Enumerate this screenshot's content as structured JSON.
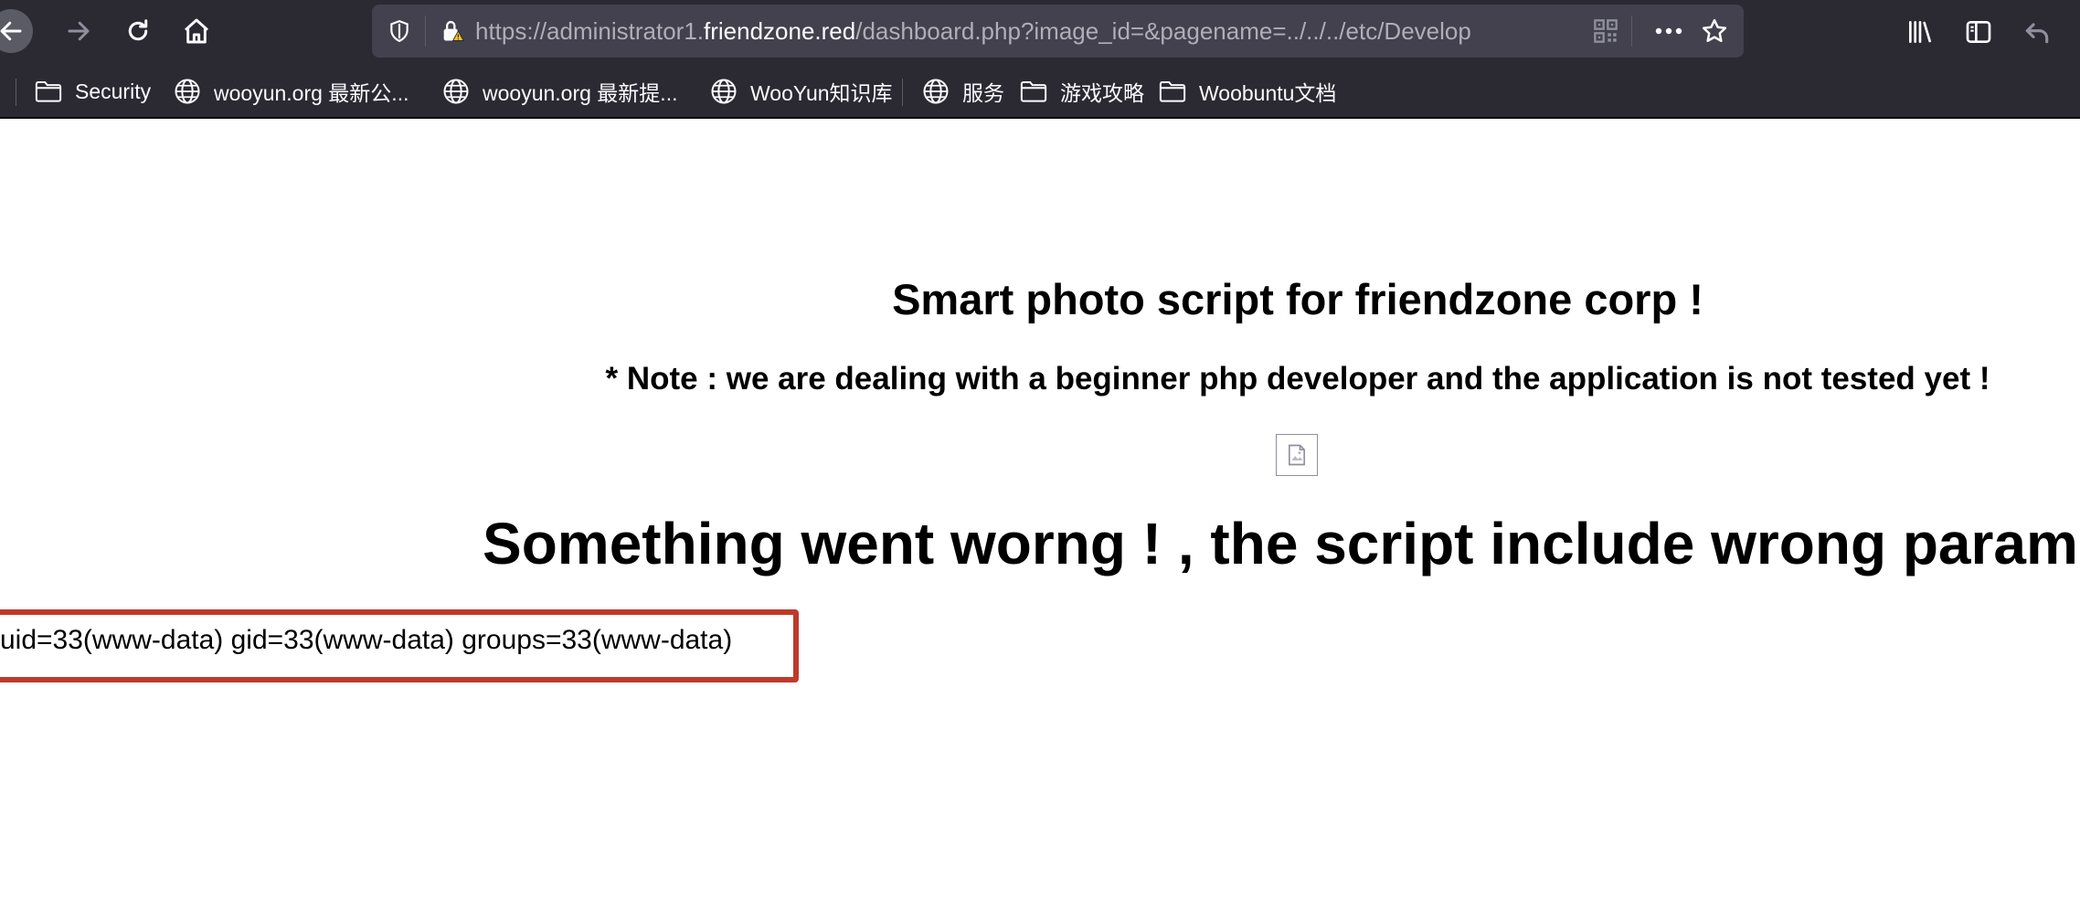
{
  "browser": {
    "url_prefix": "https://administrator1.",
    "url_host": "friendzone.red",
    "url_path": "/dashboard.php?image_id=&pagename=../../../etc/Develop",
    "icons": [
      "back-arrow-icon",
      "forward-arrow-icon",
      "reload-icon",
      "home-icon",
      "tracking-protection-shield-icon",
      "insecure-lock-icon",
      "qr-code-icon",
      "more-options-icon",
      "bookmark-star-icon",
      "library-icon",
      "sidebar-icon",
      "undo-arrow-icon"
    ],
    "colors": {
      "toolbar_bg": "#2b2a33",
      "urlbar_bg": "#42414d",
      "warning": "#f5c518"
    }
  },
  "bookmarks": [
    {
      "label": "Security",
      "icon": "folder-icon"
    },
    {
      "label": "wooyun.org 最新公...",
      "icon": "globe-icon"
    },
    {
      "label": "wooyun.org 最新提...",
      "icon": "globe-icon"
    },
    {
      "label": "WooYun知识库",
      "icon": "globe-icon"
    },
    {
      "label": "服务",
      "icon": "globe-icon"
    },
    {
      "label": "游戏攻略",
      "icon": "folder-icon"
    },
    {
      "label": "Woobuntu文档",
      "icon": "folder-icon"
    }
  ],
  "page": {
    "title": "Smart photo script for friendzone corp !",
    "note": "* Note : we are dealing with a beginner php developer and the application is not tested yet !",
    "broken_image_icon": "broken-image-icon",
    "error": "Something went worng ! , the script include wrong param",
    "command_output": "uid=33(www-data) gid=33(www-data) groups=33(www-data)",
    "highlight_color": "#c0392b"
  }
}
